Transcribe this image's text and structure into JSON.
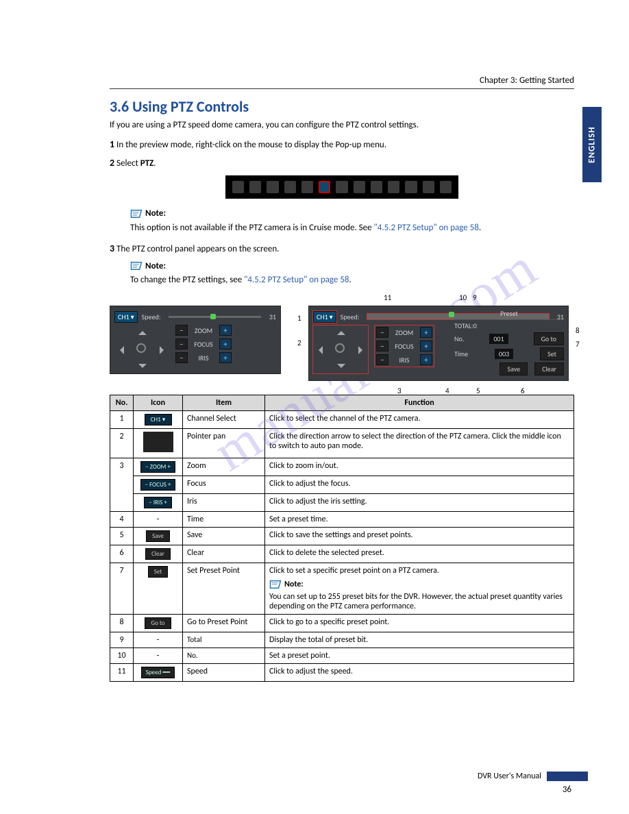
{
  "chapter_header": "Chapter 3: Getting Started",
  "lang_tab": "ENGLISH",
  "section_title": "3.6 Using PTZ Controls",
  "intro": "If you are using a PTZ speed dome camera, you can configure the PTZ control settings.",
  "step1_num": "1",
  "step1_text": " In the preview mode, right-click on the mouse to display the Pop-up menu.",
  "step2_num": "2",
  "step2_txt_pre": " Select ",
  "step2_bold": "PTZ",
  "step2_period": ".",
  "note1_label": "Note:",
  "note1_text_a": "This option is not available if the PTZ camera is in Cruise mode. See ",
  "note1_link": "\"4.5.2 PTZ Setup\" on page 58",
  "note1_text_b": ".",
  "step3_num": "3",
  "step3_text": " The PTZ control panel appears on the screen.",
  "note2_label": "Note:",
  "note2_text_a": "To change the PTZ settings, see ",
  "note2_link": "\"4.5.2 PTZ Setup\" on page 58",
  "note2_text_b": ".",
  "panel": {
    "ch_label": "CH1",
    "speed_label": "Speed:",
    "speed_value": "31",
    "zoom": "ZOOM",
    "focus": "FOCUS",
    "iris": "IRIS",
    "minus": "−",
    "plus": "+",
    "preset_hdr": "Preset",
    "total": "TOTAL:0",
    "no_label": "No.",
    "no_val": "001",
    "time_label": "Time",
    "time_val": "003",
    "goto": "Go to",
    "set": "Set",
    "save": "Save",
    "clear": "Clear"
  },
  "callout": {
    "c11": "11",
    "c10": "10",
    "c9": "9",
    "c1": "1",
    "c2": "2",
    "c3": "3",
    "c4": "4",
    "c5": "5",
    "c6": "6",
    "c7": "7",
    "c8": "8"
  },
  "table": {
    "headers": {
      "no": "No.",
      "icon": "Icon",
      "item": "Item",
      "func": "Function"
    },
    "rows": [
      {
        "no": "1",
        "icon_text": "CH1 ▾",
        "item": "Channel Select",
        "func": "Click to select the channel of the PTZ camera."
      },
      {
        "no": "2",
        "icon_text": "dpad",
        "item": "Pointer pan",
        "func": "Click the direction arrow to select the direction of the PTZ camera. Click the middle icon to switch to auto pan mode."
      },
      {
        "no": "3a",
        "icon_text": "− ZOOM +",
        "item": "Zoom",
        "func": "Click to zoom in/out."
      },
      {
        "no": "3b",
        "icon_text": "− FOCUS +",
        "item": "Focus",
        "func": "Click to adjust the focus."
      },
      {
        "no": "3c",
        "icon_text": "− IRIS +",
        "item": "Iris",
        "func": "Click to adjust the iris setting."
      },
      {
        "no": "4",
        "icon_text": "-",
        "item": "Time",
        "func": "Set a preset time."
      },
      {
        "no": "5",
        "icon_text": "Save",
        "item": "Save",
        "func": "Click to save the settings and preset points."
      },
      {
        "no": "6",
        "icon_text": "Clear",
        "item": "Clear",
        "func": "Click to delete the selected preset."
      },
      {
        "no": "7",
        "icon_text": "Set",
        "item": "Set Preset Point",
        "func": "Click to set a specific preset point on a PTZ camera.",
        "has_note": true,
        "note_label": "Note:",
        "note_body": "You can set up to 255 preset bits for the DVR. However, the actual preset quantity varies depending on the PTZ camera performance."
      },
      {
        "no": "8",
        "icon_text": "Go to",
        "item": "Go to Preset Point",
        "func": "Click to go to a specific preset point."
      },
      {
        "no": "9",
        "icon_text": "-",
        "item": "Total",
        "func": "Display the total of preset bit."
      },
      {
        "no": "10",
        "icon_text": "-",
        "item": "No.",
        "func": "Set a preset point."
      },
      {
        "no": "11",
        "icon_text": "Speed ━━",
        "item": "Speed",
        "func": "Click to adjust the speed."
      }
    ]
  },
  "footer_text": "DVR User's Manual",
  "page_number": "36",
  "watermark": "manualslib.com"
}
